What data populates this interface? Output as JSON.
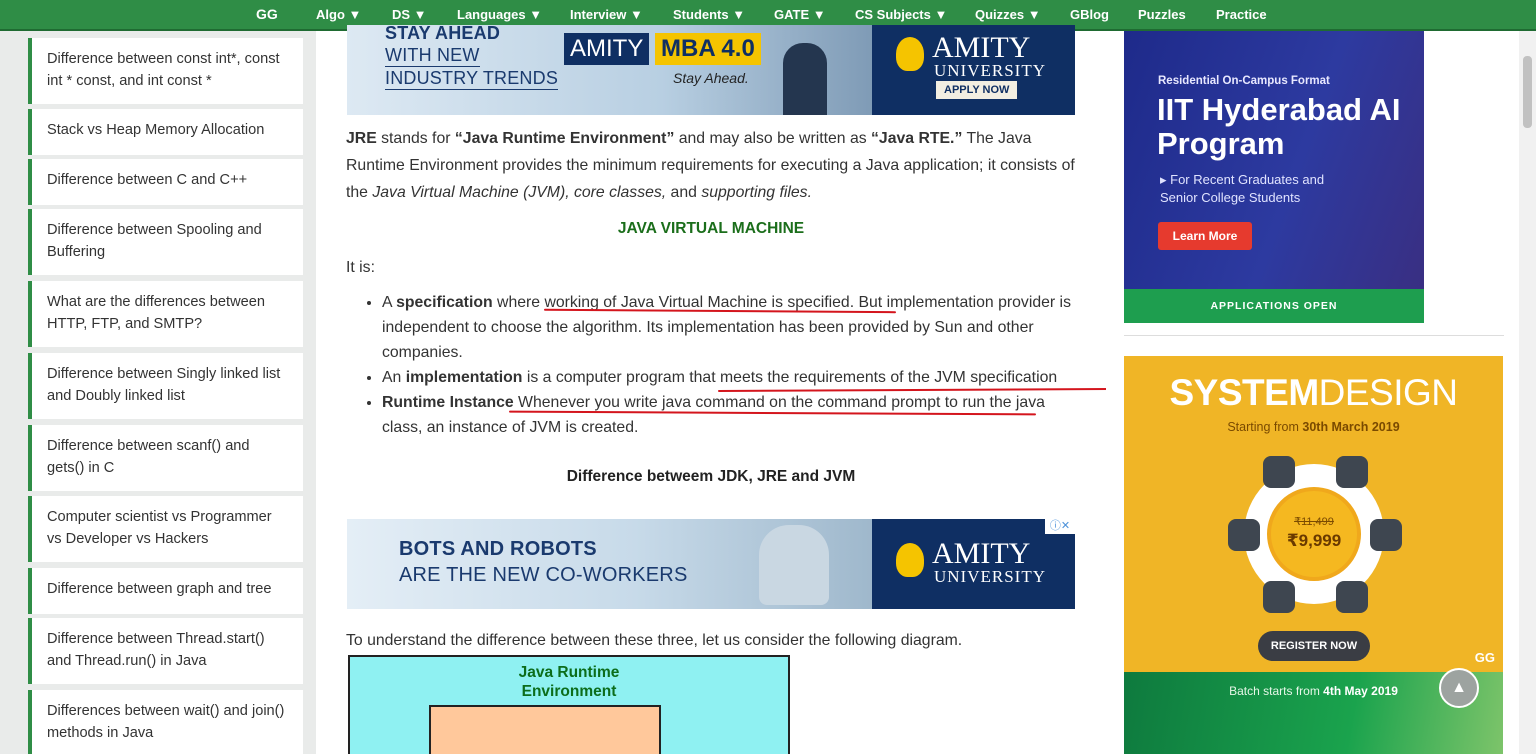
{
  "nav": {
    "logo": "GG",
    "items": [
      "Algo ▼",
      "DS ▼",
      "Languages ▼",
      "Interview ▼",
      "Students ▼",
      "GATE ▼",
      "CS Subjects ▼",
      "Quizzes ▼",
      "GBlog",
      "Puzzles",
      "Practice"
    ]
  },
  "sidebar": {
    "items": [
      "Difference between const int*, const int * const, and int const *",
      "Stack vs Heap Memory Allocation",
      "Difference between C and C++",
      "Difference between Spooling and Buffering",
      "What are the differences between HTTP, FTP, and SMTP?",
      "Difference between Singly linked list and Doubly linked list",
      "Difference between scanf() and gets() in C",
      "Computer scientist vs Programmer vs Developer vs Hackers",
      "Difference between graph and tree",
      "Difference between Thread.start() and Thread.run() in Java",
      "Differences between wait() and join() methods in Java"
    ]
  },
  "ad1": {
    "line1": "STAY AHEAD",
    "line2": "WITH NEW",
    "line3": "INDUSTRY TRENDS",
    "badge_a": "AMITY",
    "badge_b": "MBA 4.0",
    "tag": "Stay Ahead.",
    "brand": "AMITY",
    "brand_sub": "UNIVERSITY",
    "cta": "APPLY NOW"
  },
  "article": {
    "intro_b1": "JRE",
    "intro_t1": " stands for ",
    "intro_b2": "“Java Runtime Environment”",
    "intro_t2": " and may also be written as ",
    "intro_b3": "“Java RTE.”",
    "intro_t3": " The Java Runtime Environment provides the minimum requirements for executing a Java application; it consists of the ",
    "intro_i1": "Java Virtual Machine (JVM), core classes,",
    "intro_t4": " and ",
    "intro_i2": "supporting files.",
    "jvm_heading": "JAVA VIRTUAL MACHINE",
    "it_is": "It is:",
    "bullet1_pre": "A ",
    "bullet1_b": "specification",
    "bullet1_post": " where working of Java Virtual Machine is specified. But implementation provider is independent to choose the algorithm. Its implementation has been provided by Sun and other companies.",
    "bullet2_pre": "An ",
    "bullet2_b": "implementation",
    "bullet2_post": " is a computer program that meets the requirements of the JVM specification",
    "bullet3_b": "Runtime Instance",
    "bullet3_post": " Whenever you write java command on the command prompt to run the java class, an instance of JVM is created.",
    "diff_heading": "Difference betweem JDK, JRE and JVM",
    "understand": "To understand the difference between these three, let us consider the following diagram.",
    "diagram_title": "Java Runtime Environment"
  },
  "ad2": {
    "line1": "BOTS AND ROBOTS",
    "line2": "ARE THE NEW CO-WORKERS",
    "brand": "AMITY",
    "brand_sub": "UNIVERSITY",
    "x": "ⓘ✕"
  },
  "ad_iit": {
    "res": "Residential On-Campus Format",
    "title": "IIT Hyderabad AI Program",
    "sub": "▸ For Recent Graduates and Senior College Students",
    "btn": "Learn More",
    "foot": "APPLICATIONS OPEN"
  },
  "ad_sys": {
    "title_a": "SYSTEM",
    "title_b": "DESIGN",
    "start_pre": "Starting from ",
    "start_b": "30th March 2019",
    "old_price": "₹11,499",
    "price": "₹9,999",
    "reg": "REGISTER NOW",
    "logo": "GG",
    "batch_pre": "Batch starts from ",
    "batch_b": "4th May 2019"
  },
  "scroll_top": "▲",
  "colors": {
    "brand_green": "#2f8d46",
    "heading_green": "#1b6e1b",
    "underline_red": "#d4151d"
  }
}
